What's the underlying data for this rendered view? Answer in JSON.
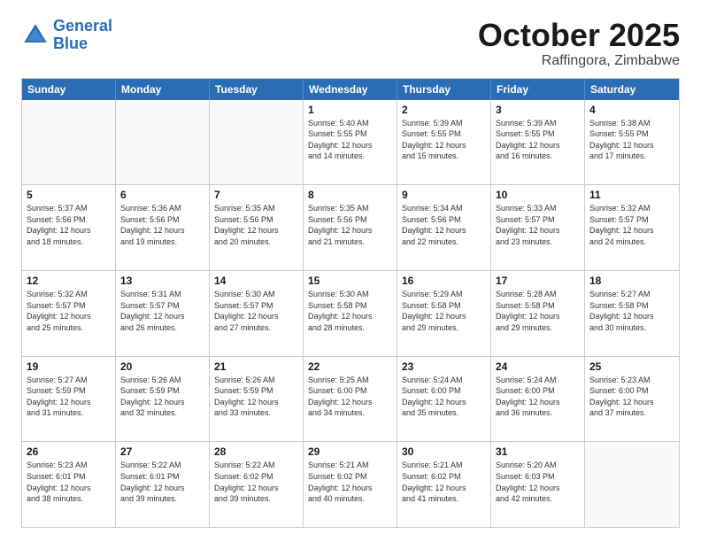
{
  "header": {
    "logo_line1": "General",
    "logo_line2": "Blue",
    "month": "October 2025",
    "location": "Raffingora, Zimbabwe"
  },
  "weekdays": [
    "Sunday",
    "Monday",
    "Tuesday",
    "Wednesday",
    "Thursday",
    "Friday",
    "Saturday"
  ],
  "rows": [
    [
      {
        "day": "",
        "text": "",
        "shaded": true
      },
      {
        "day": "",
        "text": "",
        "shaded": true
      },
      {
        "day": "",
        "text": "",
        "shaded": true
      },
      {
        "day": "1",
        "text": "Sunrise: 5:40 AM\nSunset: 5:55 PM\nDaylight: 12 hours\nand 14 minutes."
      },
      {
        "day": "2",
        "text": "Sunrise: 5:39 AM\nSunset: 5:55 PM\nDaylight: 12 hours\nand 15 minutes."
      },
      {
        "day": "3",
        "text": "Sunrise: 5:39 AM\nSunset: 5:55 PM\nDaylight: 12 hours\nand 16 minutes."
      },
      {
        "day": "4",
        "text": "Sunrise: 5:38 AM\nSunset: 5:55 PM\nDaylight: 12 hours\nand 17 minutes."
      }
    ],
    [
      {
        "day": "5",
        "text": "Sunrise: 5:37 AM\nSunset: 5:56 PM\nDaylight: 12 hours\nand 18 minutes."
      },
      {
        "day": "6",
        "text": "Sunrise: 5:36 AM\nSunset: 5:56 PM\nDaylight: 12 hours\nand 19 minutes."
      },
      {
        "day": "7",
        "text": "Sunrise: 5:35 AM\nSunset: 5:56 PM\nDaylight: 12 hours\nand 20 minutes."
      },
      {
        "day": "8",
        "text": "Sunrise: 5:35 AM\nSunset: 5:56 PM\nDaylight: 12 hours\nand 21 minutes."
      },
      {
        "day": "9",
        "text": "Sunrise: 5:34 AM\nSunset: 5:56 PM\nDaylight: 12 hours\nand 22 minutes."
      },
      {
        "day": "10",
        "text": "Sunrise: 5:33 AM\nSunset: 5:57 PM\nDaylight: 12 hours\nand 23 minutes."
      },
      {
        "day": "11",
        "text": "Sunrise: 5:32 AM\nSunset: 5:57 PM\nDaylight: 12 hours\nand 24 minutes."
      }
    ],
    [
      {
        "day": "12",
        "text": "Sunrise: 5:32 AM\nSunset: 5:57 PM\nDaylight: 12 hours\nand 25 minutes."
      },
      {
        "day": "13",
        "text": "Sunrise: 5:31 AM\nSunset: 5:57 PM\nDaylight: 12 hours\nand 26 minutes."
      },
      {
        "day": "14",
        "text": "Sunrise: 5:30 AM\nSunset: 5:57 PM\nDaylight: 12 hours\nand 27 minutes."
      },
      {
        "day": "15",
        "text": "Sunrise: 5:30 AM\nSunset: 5:58 PM\nDaylight: 12 hours\nand 28 minutes."
      },
      {
        "day": "16",
        "text": "Sunrise: 5:29 AM\nSunset: 5:58 PM\nDaylight: 12 hours\nand 29 minutes."
      },
      {
        "day": "17",
        "text": "Sunrise: 5:28 AM\nSunset: 5:58 PM\nDaylight: 12 hours\nand 29 minutes."
      },
      {
        "day": "18",
        "text": "Sunrise: 5:27 AM\nSunset: 5:58 PM\nDaylight: 12 hours\nand 30 minutes."
      }
    ],
    [
      {
        "day": "19",
        "text": "Sunrise: 5:27 AM\nSunset: 5:59 PM\nDaylight: 12 hours\nand 31 minutes."
      },
      {
        "day": "20",
        "text": "Sunrise: 5:26 AM\nSunset: 5:59 PM\nDaylight: 12 hours\nand 32 minutes."
      },
      {
        "day": "21",
        "text": "Sunrise: 5:26 AM\nSunset: 5:59 PM\nDaylight: 12 hours\nand 33 minutes."
      },
      {
        "day": "22",
        "text": "Sunrise: 5:25 AM\nSunset: 6:00 PM\nDaylight: 12 hours\nand 34 minutes."
      },
      {
        "day": "23",
        "text": "Sunrise: 5:24 AM\nSunset: 6:00 PM\nDaylight: 12 hours\nand 35 minutes."
      },
      {
        "day": "24",
        "text": "Sunrise: 5:24 AM\nSunset: 6:00 PM\nDaylight: 12 hours\nand 36 minutes."
      },
      {
        "day": "25",
        "text": "Sunrise: 5:23 AM\nSunset: 6:00 PM\nDaylight: 12 hours\nand 37 minutes."
      }
    ],
    [
      {
        "day": "26",
        "text": "Sunrise: 5:23 AM\nSunset: 6:01 PM\nDaylight: 12 hours\nand 38 minutes."
      },
      {
        "day": "27",
        "text": "Sunrise: 5:22 AM\nSunset: 6:01 PM\nDaylight: 12 hours\nand 39 minutes."
      },
      {
        "day": "28",
        "text": "Sunrise: 5:22 AM\nSunset: 6:02 PM\nDaylight: 12 hours\nand 39 minutes."
      },
      {
        "day": "29",
        "text": "Sunrise: 5:21 AM\nSunset: 6:02 PM\nDaylight: 12 hours\nand 40 minutes."
      },
      {
        "day": "30",
        "text": "Sunrise: 5:21 AM\nSunset: 6:02 PM\nDaylight: 12 hours\nand 41 minutes."
      },
      {
        "day": "31",
        "text": "Sunrise: 5:20 AM\nSunset: 6:03 PM\nDaylight: 12 hours\nand 42 minutes."
      },
      {
        "day": "",
        "text": "",
        "shaded": true
      }
    ]
  ]
}
